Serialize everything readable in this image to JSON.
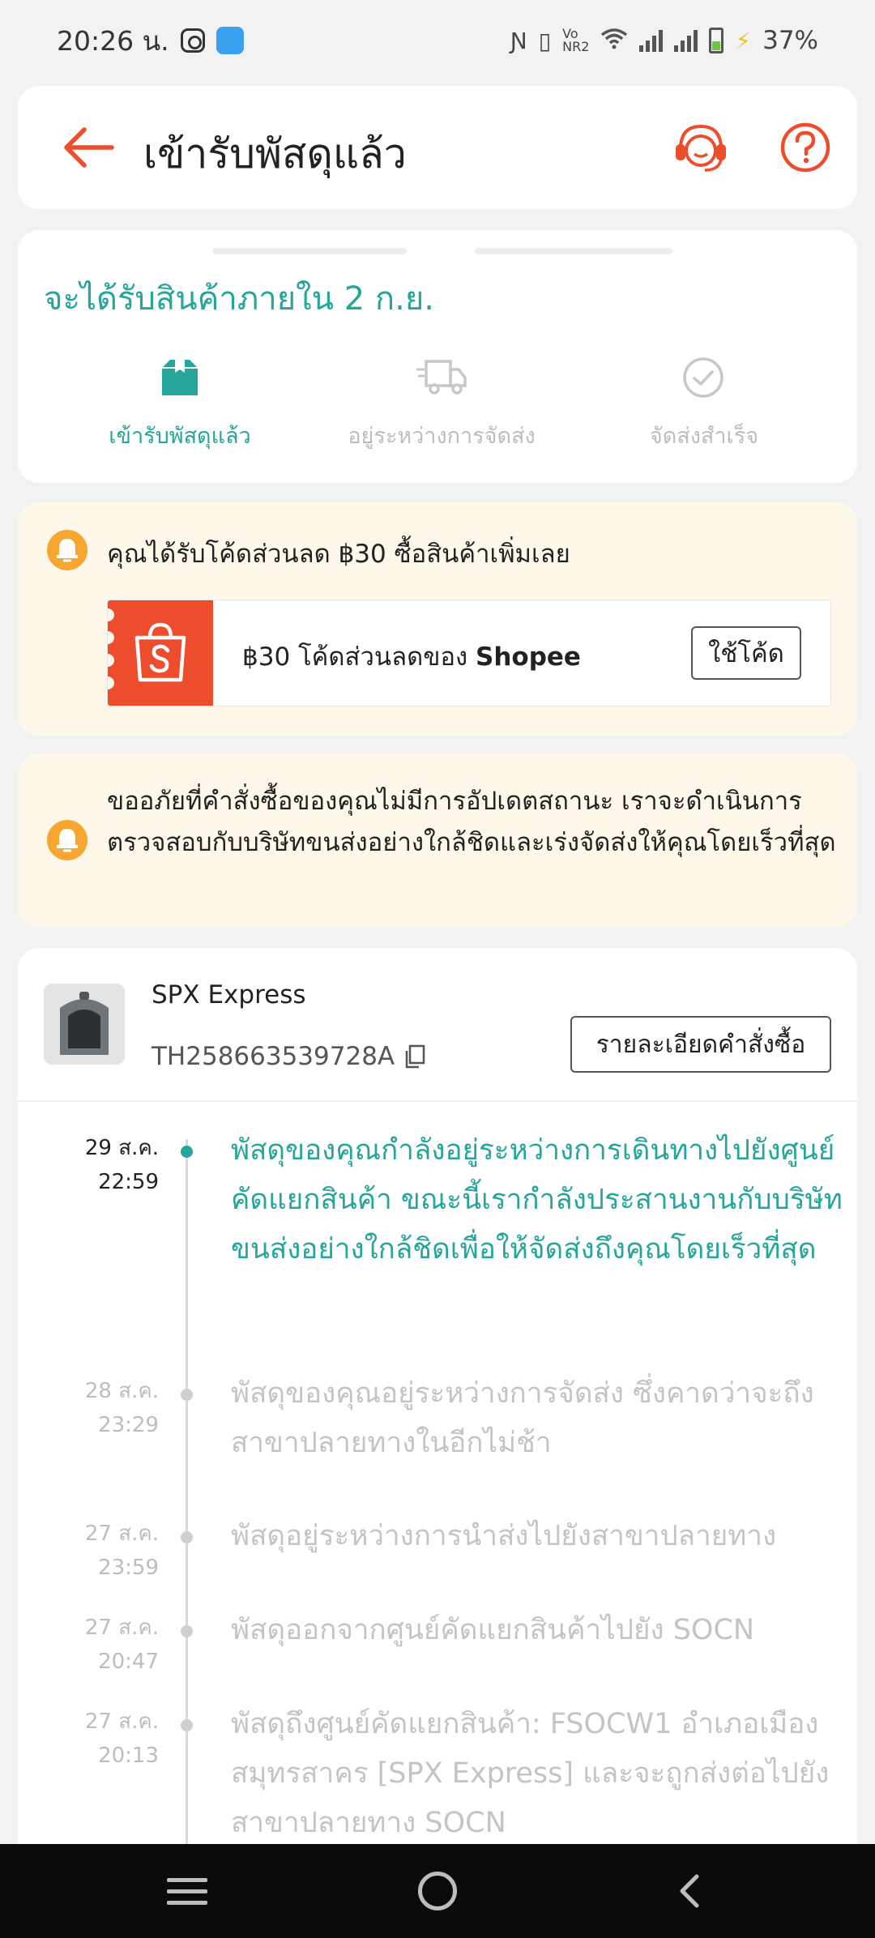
{
  "status_bar": {
    "time": "20:26 น.",
    "battery": "37%",
    "network_label": "NR2"
  },
  "header": {
    "title": "เข้ารับพัสดุแล้ว"
  },
  "eta": {
    "text": "จะได้รับสินค้าภายใน 2 ก.ย.",
    "steps": [
      {
        "label": "เข้ารับพัสดุแล้ว",
        "active": true,
        "icon": "box-icon"
      },
      {
        "label": "อยู่ระหว่างการจัดส่ง",
        "active": false,
        "icon": "truck-icon"
      },
      {
        "label": "จัดส่งสำเร็จ",
        "active": false,
        "icon": "check-circle-icon"
      }
    ]
  },
  "promo": {
    "text": "คุณได้รับโค้ดส่วนลด ฿30 ซื้อสินค้าเพิ่มเลย",
    "voucher_amount": "฿30",
    "voucher_desc": "โค้ดส่วนลดของ",
    "voucher_brand": "Shopee",
    "use_code_label": "ใช้โค้ด"
  },
  "notice": {
    "text": "ขออภัยที่คำสั่งซื้อของคุณไม่มีการอัปเดตสถานะ เราจะดำเนินการตรวจสอบกับบริษัทขนส่งอย่างใกล้ชิดและเร่งจัดส่งให้คุณโดยเร็วที่สุด"
  },
  "tracking": {
    "carrier": "SPX Express",
    "tracking_number": "TH258663539728A",
    "order_detail_label": "รายละเอียดคำสั่งซื้อ",
    "events": [
      {
        "date": "29 ส.ค.",
        "time": "22:59",
        "desc": "พัสดุของคุณกำลังอยู่ระหว่างการเดินทางไปยังศูนย์คัดแยกสินค้า ขณะนี้เรากำลังประสานงานกับบริษัทขนส่งอย่างใกล้ชิดเพื่อให้จัดส่งถึงคุณโดยเร็วที่สุด",
        "active": true
      },
      {
        "date": "28 ส.ค.",
        "time": "23:29",
        "desc": "พัสดุของคุณอยู่ระหว่างการจัดส่ง ซึ่งคาดว่าจะถึงสาขาปลายทางในอีกไม่ช้า",
        "active": false
      },
      {
        "date": "27 ส.ค.",
        "time": "23:59",
        "desc": "พัสดุอยู่ระหว่างการนำส่งไปยังสาขาปลายทาง",
        "active": false
      },
      {
        "date": "27 ส.ค.",
        "time": "20:47",
        "desc": "พัสดุออกจากศูนย์คัดแยกสินค้าไปยัง SOCN",
        "active": false
      },
      {
        "date": "27 ส.ค.",
        "time": "20:13",
        "desc": "พัสดุถึงศูนย์คัดแยกสินค้า: FSOCW1 อำเภอเมืองสมุทรสาคร [SPX Express] และจะถูกส่งต่อไปยังสาขาปลายทาง SOCN",
        "active": false
      }
    ]
  },
  "colors": {
    "brand_orange": "#ee4d2d",
    "teal": "#26a69a",
    "bell_orange": "#f7a631",
    "notice_bg": "#fdf8ea"
  }
}
